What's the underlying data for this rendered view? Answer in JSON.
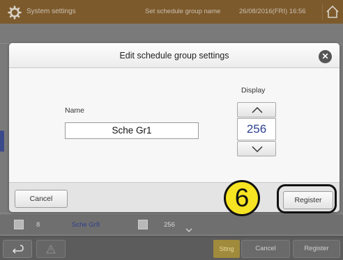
{
  "topbar": {
    "app_title": "System settings",
    "screen_title": "Set schedule group name",
    "datetime": "26/08/2016(FRI) 16:56"
  },
  "background_row": {
    "number": "8",
    "name": "Sche Gr8",
    "value": "256"
  },
  "bottombar": {
    "settings_label": "Sttng",
    "cancel_label": "Cancel",
    "register_label": "Register"
  },
  "dialog": {
    "title": "Edit schedule group settings",
    "name_label": "Name",
    "name_value": "Sche Gr1",
    "display_label": "Display",
    "display_value": "256",
    "cancel_label": "Cancel",
    "register_label": "Register"
  },
  "annotation": {
    "step_number": "6",
    "color": "#f6e321"
  },
  "icons": {
    "gear": "gear-icon",
    "home": "home-icon",
    "close": "close-icon",
    "up": "chevron-up-icon",
    "down": "chevron-down-icon",
    "back": "back-arrow-icon",
    "warning": "warning-icon"
  }
}
